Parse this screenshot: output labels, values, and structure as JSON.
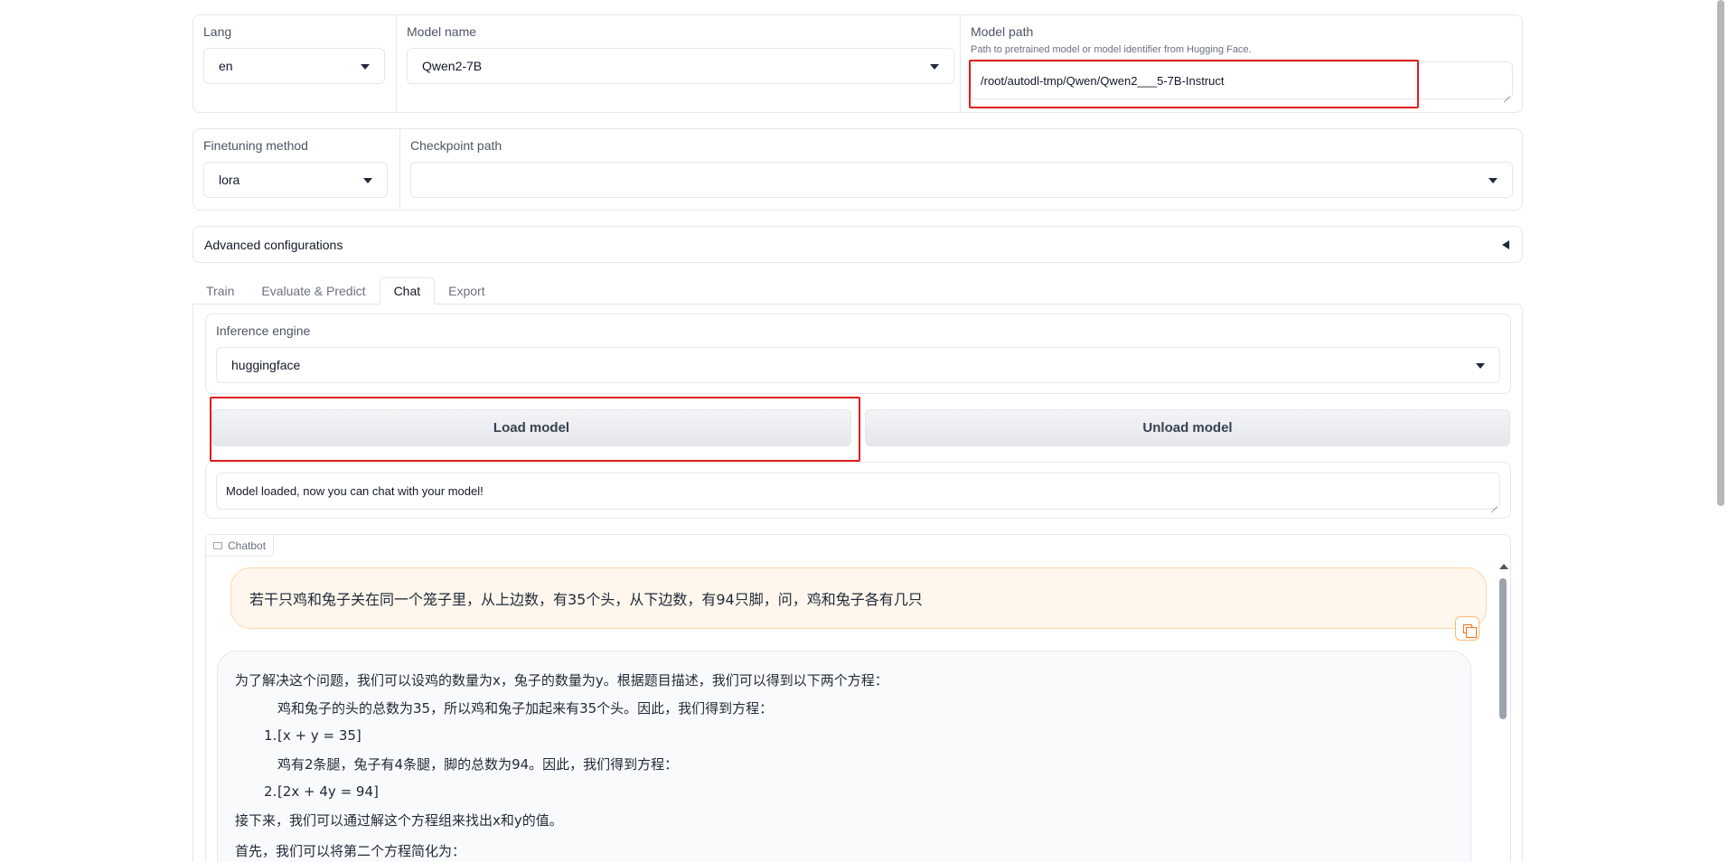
{
  "top_row": {
    "lang": {
      "label": "Lang",
      "value": "en"
    },
    "model_name": {
      "label": "Model name",
      "value": "Qwen2-7B"
    },
    "model_path": {
      "label": "Model path",
      "info": "Path to pretrained model or model identifier from Hugging Face.",
      "value": "/root/autodl-tmp/Qwen/Qwen2___5-7B-Instruct"
    }
  },
  "second_row": {
    "finetuning_method": {
      "label": "Finetuning method",
      "value": "lora"
    },
    "checkpoint_path": {
      "label": "Checkpoint path",
      "value": ""
    }
  },
  "advanced": {
    "label": "Advanced configurations"
  },
  "tabs": [
    {
      "label": "Train",
      "active": false
    },
    {
      "label": "Evaluate & Predict",
      "active": false
    },
    {
      "label": "Chat",
      "active": true
    },
    {
      "label": "Export",
      "active": false
    }
  ],
  "chat": {
    "inference_engine": {
      "label": "Inference engine",
      "value": "huggingface"
    },
    "load_button": "Load model",
    "unload_button": "Unload model",
    "status": "Model loaded, now you can chat with your model!",
    "chatbot_label": "Chatbot",
    "user_message": "若干只鸡和兔子关在同一个笼子里，从上边数，有35个头，从下边数，有94只脚，问，鸡和兔子各有几只",
    "bot": {
      "intro": "为了解决这个问题，我们可以设鸡的数量为x，兔子的数量为y。根据题目描述，我们可以得到以下两个方程：",
      "step1_text": "鸡和兔子的头的总数为35，所以鸡和兔子加起来有35个头。因此，我们得到方程：",
      "eq1_num": "1.",
      "eq1": "[x + y = 35]",
      "step2_text": "鸡有2条腿，兔子有4条腿，脚的总数为94。因此，我们得到方程：",
      "eq2_num": "2.",
      "eq2": "[2x + 4y = 94]",
      "next": "接下来，我们可以通过解这个方程组来找出x和y的值。",
      "first": "首先，我们可以将第二个方程简化为："
    }
  },
  "colors": {
    "highlight": "#e11d1d",
    "user_bubble": "#fff7ed",
    "user_border": "#fed7aa",
    "bot_bubble": "#f9fafb"
  }
}
